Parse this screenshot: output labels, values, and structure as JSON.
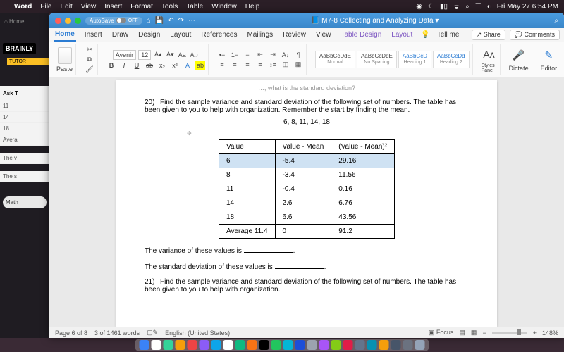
{
  "mac_menu": {
    "app": "Word",
    "items": [
      "File",
      "Edit",
      "View",
      "Insert",
      "Format",
      "Tools",
      "Table",
      "Window",
      "Help"
    ],
    "clock": "Fri May 27  6:54 PM"
  },
  "brainly": {
    "logo": "BRAINLY",
    "tutor": "TUTOR",
    "ask": "Ask T",
    "rows": [
      "11",
      "14",
      "18",
      "Avera"
    ],
    "line1": "The v",
    "line2": "The s",
    "math": "Math"
  },
  "titlebar": {
    "autosave": "AutoSave",
    "autosave_state": "OFF",
    "doc": "M7-8 Collecting and Analyzing Data"
  },
  "ribbon_tabs": [
    "Home",
    "Insert",
    "Draw",
    "Design",
    "Layout",
    "References",
    "Mailings",
    "Review",
    "View",
    "Table Design",
    "Layout"
  ],
  "tell_me": "Tell me",
  "share": "Share",
  "comments": "Comments",
  "ribbon": {
    "paste": "Paste",
    "font_name": "Avenir",
    "font_size": "12",
    "styles": [
      {
        "sample": "AaBbCcDdE",
        "name": "Normal"
      },
      {
        "sample": "AaBbCcDdE",
        "name": "No Spacing"
      },
      {
        "sample": "AaBbCcD",
        "name": "Heading 1"
      },
      {
        "sample": "AaBbCcDd",
        "name": "Heading 2"
      }
    ],
    "styles_pane": "Styles Pane",
    "dictate": "Dictate",
    "editor": "Editor"
  },
  "doc": {
    "cutline": "…, what is the standard deviation?",
    "q20_num": "20)",
    "q20": "Find the sample variance and standard deviation of the following set of numbers.  The table has been given to you to help with organization. Remember the start by finding the mean.",
    "dataset": "6, 8, 11, 14, 18",
    "th": [
      "Value",
      "Value - Mean",
      "(Value - Mean)²"
    ],
    "rows": [
      [
        "6",
        "-5.4",
        "29.16"
      ],
      [
        "8",
        "-3.4",
        "11.56"
      ],
      [
        "11",
        "-0.4",
        "0.16"
      ],
      [
        "14",
        "2.6",
        "6.76"
      ],
      [
        "18",
        "6.6",
        "43.56"
      ]
    ],
    "avg_row": [
      "Average 11.4",
      "0",
      "91.2"
    ],
    "variance_stmt": "The variance of these values is ",
    "stddev_stmt": "The standard deviation of these values is ",
    "q21_num": "21)",
    "q21": "Find the sample variance and standard deviation of the following set of numbers.  The table has been given to you to help with organization."
  },
  "chart_data": {
    "type": "table",
    "title": "Sample variance worksheet (Q20)",
    "columns": [
      "Value",
      "Value - Mean",
      "(Value - Mean)^2"
    ],
    "rows": [
      {
        "Value": 6,
        "Value - Mean": -5.4,
        "(Value - Mean)^2": 29.16
      },
      {
        "Value": 8,
        "Value - Mean": -3.4,
        "(Value - Mean)^2": 11.56
      },
      {
        "Value": 11,
        "Value - Mean": -0.4,
        "(Value - Mean)^2": 0.16
      },
      {
        "Value": 14,
        "Value - Mean": 2.6,
        "(Value - Mean)^2": 6.76
      },
      {
        "Value": 18,
        "Value - Mean": 6.6,
        "(Value - Mean)^2": 43.56
      }
    ],
    "summary": {
      "Average": 11.4,
      "Sum(Value-Mean)": 0,
      "Sum(Value-Mean)^2": 91.2
    }
  },
  "status": {
    "page": "Page 6 of 8",
    "words": "3 of 1461 words",
    "lang": "English (United States)",
    "focus": "Focus",
    "zoom": "148%"
  },
  "dock_colors": [
    "#3b82f6",
    "#ffffff",
    "#34d399",
    "#f59e0b",
    "#ef4444",
    "#8b5cf6",
    "#0ea5e9",
    "#ffffff",
    "#10b981",
    "#f97316",
    "#000000",
    "#22c55e",
    "#06b6d4",
    "#1d4ed8",
    "#9ca3af",
    "#a855f7",
    "#84cc16",
    "#e11d48",
    "#64748b",
    "#0891b2",
    "#f59e0b",
    "#475569",
    "#6b7280",
    "#94a3b8"
  ]
}
